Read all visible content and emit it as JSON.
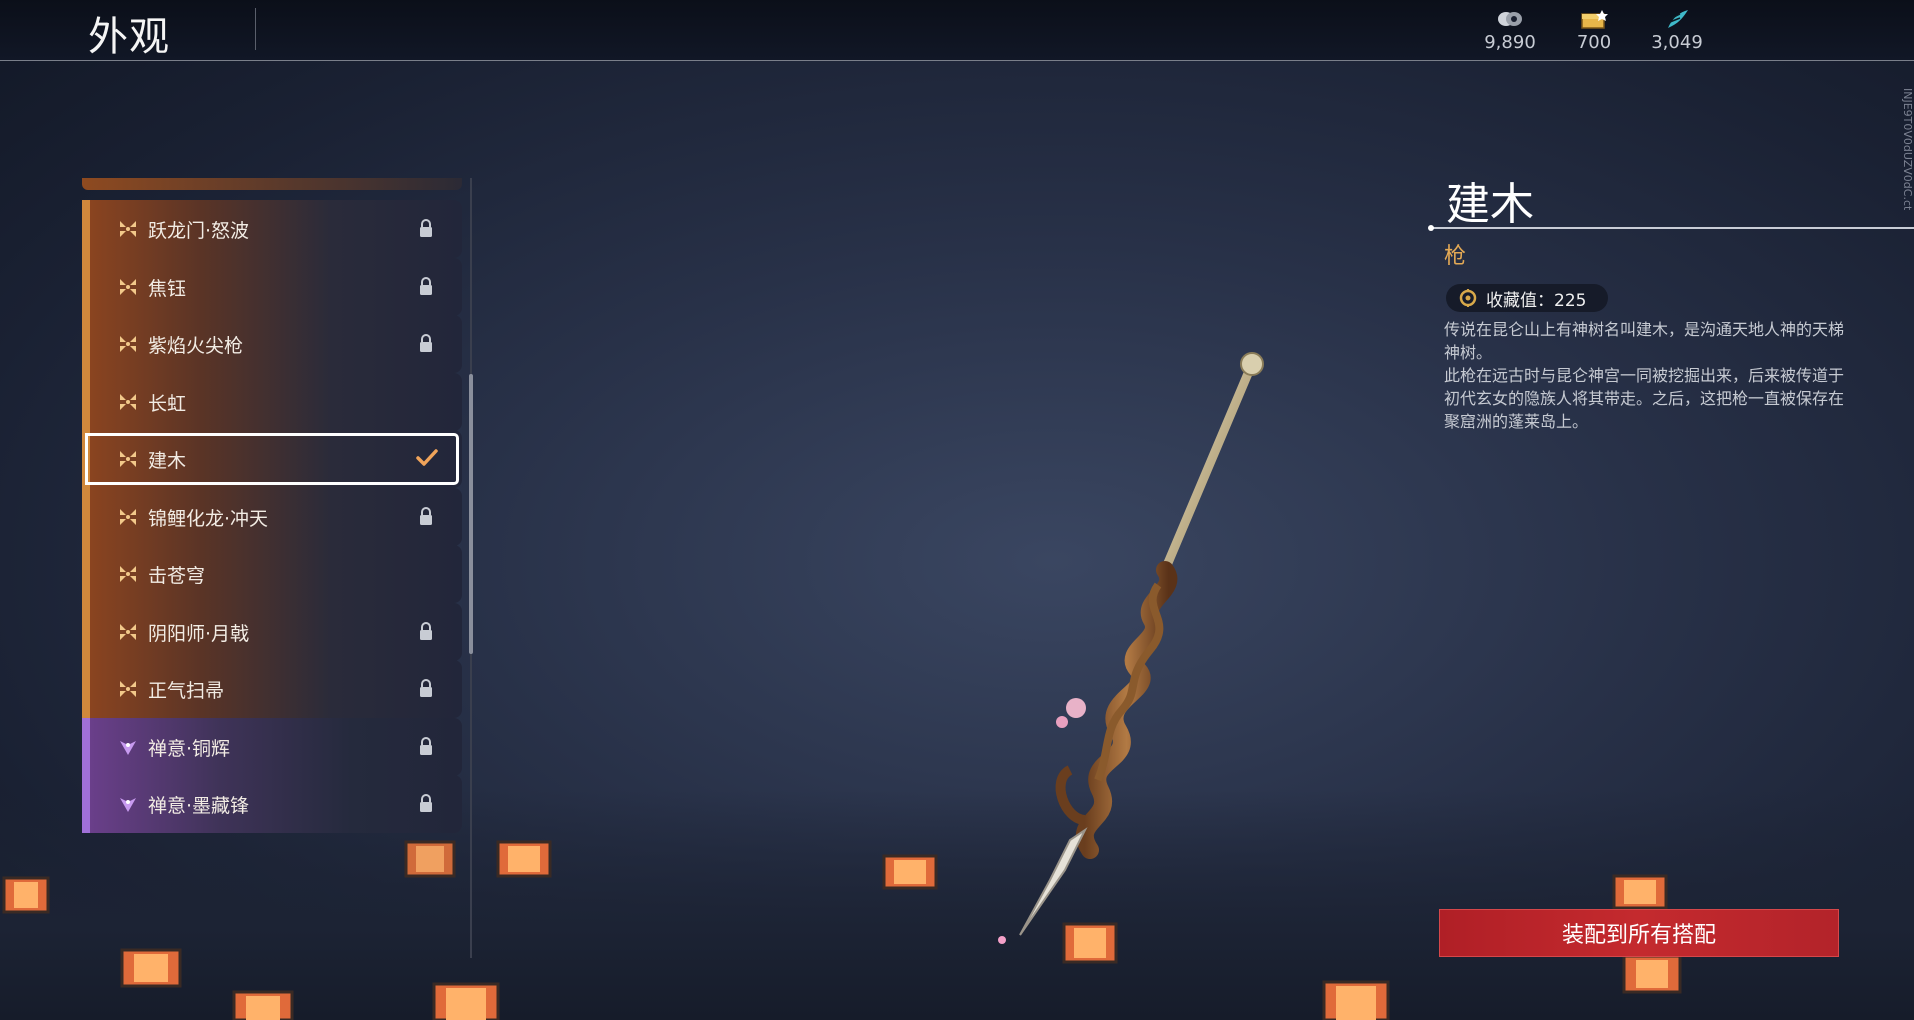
{
  "header": {
    "title": "外观"
  },
  "currencies": [
    {
      "icon": "coin-stack-icon",
      "value": "9,890"
    },
    {
      "icon": "chest-icon",
      "value": "700"
    },
    {
      "icon": "feather-token-icon",
      "value": "3,049"
    }
  ],
  "skin_list": [
    {
      "name": "跃龙门·怒波",
      "rarity": "gold",
      "locked": true,
      "selected": false
    },
    {
      "name": "焦钰",
      "rarity": "gold",
      "locked": true,
      "selected": false
    },
    {
      "name": "紫焰火尖枪",
      "rarity": "gold",
      "locked": true,
      "selected": false
    },
    {
      "name": "长虹",
      "rarity": "gold",
      "locked": false,
      "selected": false
    },
    {
      "name": "建木",
      "rarity": "gold",
      "locked": false,
      "selected": true
    },
    {
      "name": "锦鲤化龙·冲天",
      "rarity": "gold",
      "locked": true,
      "selected": false
    },
    {
      "name": "击苍穹",
      "rarity": "gold",
      "locked": false,
      "selected": false
    },
    {
      "name": "阴阳师·月戟",
      "rarity": "gold",
      "locked": true,
      "selected": false
    },
    {
      "name": "正气扫帚",
      "rarity": "gold",
      "locked": true,
      "selected": false
    },
    {
      "name": "禅意·铜辉",
      "rarity": "purple",
      "locked": true,
      "selected": false
    },
    {
      "name": "禅意·墨藏锋",
      "rarity": "purple",
      "locked": true,
      "selected": false
    }
  ],
  "detail": {
    "name": "建木",
    "type": "枪",
    "collection_label": "收藏值：225",
    "description": [
      "传说在昆仑山上有神树名叫建木，是沟通天地人神的天梯神树。",
      "此枪在远古时与昆仑神宫一同被挖掘出来，后来被传道于初代玄女的隐族人将其带走。之后，这把枪一直被保存在聚窟洲的蓬莱岛上。"
    ]
  },
  "side_text": "INJE9T0V0dUZV0dC.ct",
  "equip_button": "装配到所有搭配",
  "colors": {
    "gold_accent": "#d0883c",
    "purple_accent": "#a070d8",
    "button_red": "#c42a2e",
    "type_color": "#e3a955"
  }
}
